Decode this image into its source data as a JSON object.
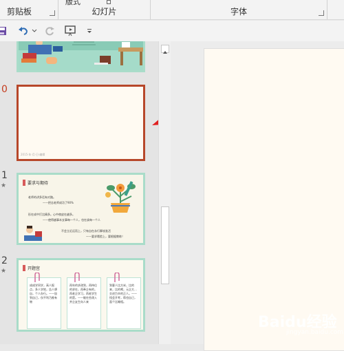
{
  "ribbon": {
    "groups": [
      {
        "label": "剪贴板"
      },
      {
        "label": "幻灯片"
      },
      {
        "label": "字体"
      }
    ],
    "partial_top_text": "版式"
  },
  "qat": {
    "items": [
      "save-icon",
      "undo-icon",
      "undo-dropdown-icon",
      "redo-icon",
      "slideshow-icon",
      "customize-dropdown-icon"
    ]
  },
  "thumbnails": {
    "slides": [
      {
        "number": "",
        "selected": false
      },
      {
        "number": "0",
        "selected": true,
        "footer_text": "2015·年·月·日·编辑"
      },
      {
        "number": "1",
        "selected": false,
        "has_star": true,
        "title": "要求与期待",
        "lines": [
          "老师的讲多话有对路。",
          "——把志老师成功了90%",
          "形在成中打比精多。心中夜皮在越多。",
          "——使得越事本支事每一个人，也在诶每一个人",
          "不会立近远而上，只有自在永行脚攻准活",
          "——要求哦脸上，要根据教练！"
        ]
      },
      {
        "number": "2",
        "selected": false,
        "has_star": true,
        "title": "开题宫",
        "cards": [
          "成成学同学，高人报点，多人学地，告人想自，个人办行。——加到自己，仅不利乃推有物",
          "再年的求改到，再待位的求在，再奉企有的，再老企学习，再老学生的是。——能在些改入并企友生向人来",
          "到客人比方米，比的来，比的喝，元企大…交进力辛的正人。——找会开考，帮也自己，面个比喻相。"
        ]
      }
    ]
  },
  "watermark": {
    "text": "Baidu经验",
    "sub": "jingyan.baidu.com"
  },
  "colors": {
    "accent": "#b7472a",
    "mint": "#a9dcc9",
    "canvas_bg": "#fffaf2"
  }
}
